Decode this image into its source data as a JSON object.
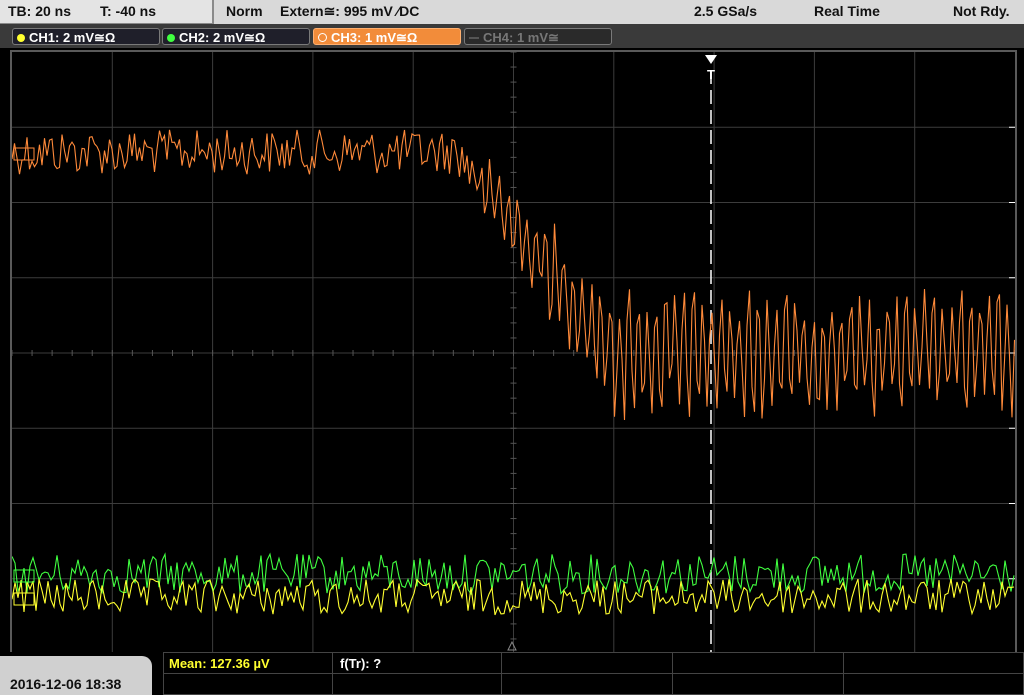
{
  "status": {
    "timebase": "TB: 20 ns",
    "trigger_time": "T: -40 ns",
    "mode": "Norm",
    "trigger_source": "Extern≅: 995 mV ∕DC",
    "sample_rate": "2.5 GSa/s",
    "acq_mode": "Real Time",
    "state": "Not Rdy."
  },
  "channels": [
    {
      "label": "CH1: 2 mV≅Ω",
      "color": "#ffff30",
      "active": false,
      "enabled": true
    },
    {
      "label": "CH2: 2 mV≅Ω",
      "color": "#40ff40",
      "active": false,
      "enabled": true
    },
    {
      "label": "CH3: 1 mV≅Ω",
      "color": "#ff8a3a",
      "active": true,
      "enabled": true
    },
    {
      "label": "CH4: 1 mV≅",
      "color": "#777777",
      "active": false,
      "enabled": false
    }
  ],
  "trigger_marker": "T",
  "footer": {
    "datetime": "2016-12-06 18:38",
    "measurement": "Mean: 127.36 µV",
    "function": "f(Tr): ?"
  },
  "colors": {
    "ch1": "#ffff30",
    "ch2": "#40ff40",
    "ch3": "#ff8a3a",
    "grid": "#3c3c3c",
    "trigger_line": "#ffffff"
  }
}
